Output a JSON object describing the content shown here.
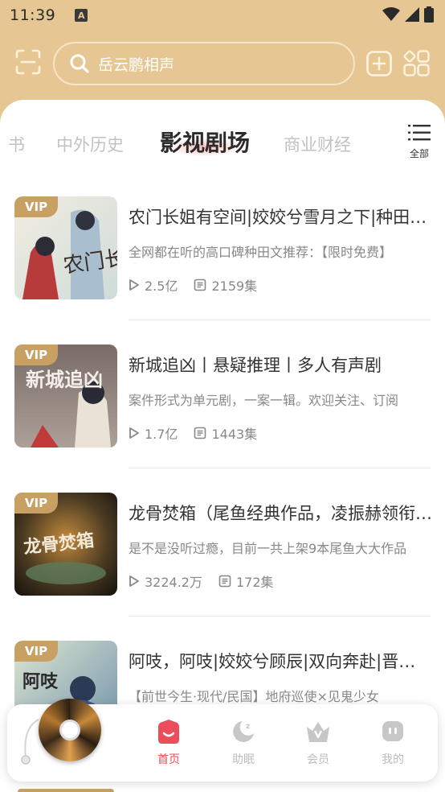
{
  "status_bar": {
    "time": "11:39",
    "notification_icon": "A"
  },
  "header": {
    "search_placeholder": "岳云鹏相声"
  },
  "tabs": {
    "partial_left": "书",
    "items": [
      "中外历史",
      "影视剧场",
      "商业财经"
    ],
    "active_index": 1,
    "all_label": "全部"
  },
  "books": [
    {
      "badge": "VIP",
      "cover_text": "农门长姐",
      "title": "农门长姐有空间|姣姣兮雪月之下|种田文推荐",
      "desc": "全网都在听的高口碑种田文推荐：【限时免费】",
      "plays": "2.5亿",
      "episodes": "2159集"
    },
    {
      "badge": "VIP",
      "cover_text": "新城追凶",
      "title": "新城追凶丨悬疑推理丨多人有声剧",
      "desc": "案件形式为单元剧，一案一辑。欢迎关注、订阅",
      "plays": "1.7亿",
      "episodes": "1443集"
    },
    {
      "badge": "VIP",
      "cover_text": "龙骨焚箱",
      "title": "龙骨焚箱（尾鱼经典作品，凌振赫领衔演播）",
      "desc": "是不是没听过瘾，目前一共上架9本尾鱼大大作品",
      "plays": "3224.2万",
      "episodes": "172集"
    },
    {
      "badge": "VIP",
      "cover_text": "阿吱",
      "title": "阿吱，阿吱|姣姣兮顾辰|双向奔赴|晋江高分",
      "desc": "【前世今生·现代/民国】地府巡使×见鬼少女",
      "plays": "",
      "episodes": ""
    }
  ],
  "bottom_nav": {
    "items": [
      {
        "label": "首页",
        "icon": "home-icon",
        "active": true
      },
      {
        "label": "助眠",
        "icon": "moon-icon",
        "active": false
      },
      {
        "label": "会员",
        "icon": "crown-icon",
        "active": false
      },
      {
        "label": "我的",
        "icon": "profile-icon",
        "active": false
      }
    ]
  },
  "colors": {
    "header_bg": "#E6C793",
    "accent": "#EB4E5A",
    "vip_badge": "#C9A064",
    "inactive": "#BDBDBD"
  }
}
